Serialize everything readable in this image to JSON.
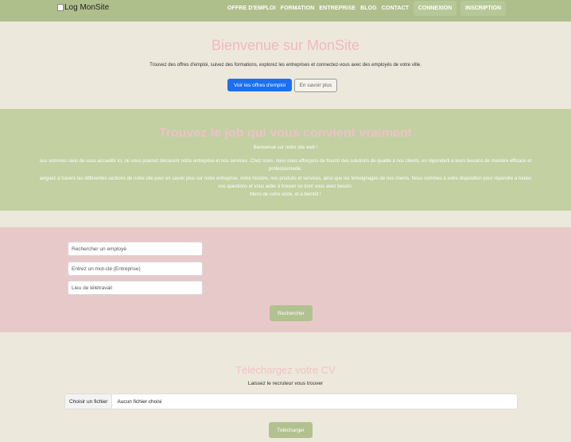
{
  "header": {
    "logo_text": "Log MonSite",
    "links": [
      "OFFRE D'EMPLOI",
      "FORMATION",
      "ENTREPRISE",
      "BLOG",
      "CONTACT"
    ],
    "login_label": "CONNEXION",
    "signup_label": "INSCRIPTION"
  },
  "hero": {
    "title": "Bienvenue sur MonSite",
    "subtitle": "Trouvez des offres d'emploi, suivez des formations, explorez les entreprises et connectez-vous avec des employés de votre ville.",
    "primary_label": "Voir les offres d'emploi",
    "secondary_label": "En savoir plus"
  },
  "intro": {
    "title": "Trouvez le job qui vous convient vraiment",
    "lines": [
      "Bienvenue sur notre site web !",
      "ous sommes ravis de vous accueillir ici, où vous pourrez découvrir notre entreprise et nos services. Chez nous, nous nous efforçons de fournir des solutions de qualité à nos clients, en répondant à leurs besoins de manière efficace et",
      "professionnelle.",
      "aviguez à travers les différentes sections de notre site pour en savoir plus sur notre entreprise, notre histoire, nos produits et services, ainsi que les témoignages de nos clients. Nous sommes à votre disposition pour répondre à toutes",
      "vos questions et vous aider à trouver ce dont vous avez besoin.",
      "Merci de votre visite, et à bientôt !"
    ]
  },
  "search": {
    "employee_placeholder": "Rechercher un employé",
    "keyword_placeholder": "Entrez un mot-clé (Entreprise)",
    "location_placeholder": "Lieu de télétravail",
    "submit_label": "Rechercher"
  },
  "cv": {
    "title": "Téléchargez votre CV",
    "subtitle": "Laissez le recruteur vous trouver",
    "choose_label": "Choisir un fichier",
    "no_file_label": "Aucun fichier choisi",
    "upload_label": "Télécharger"
  }
}
